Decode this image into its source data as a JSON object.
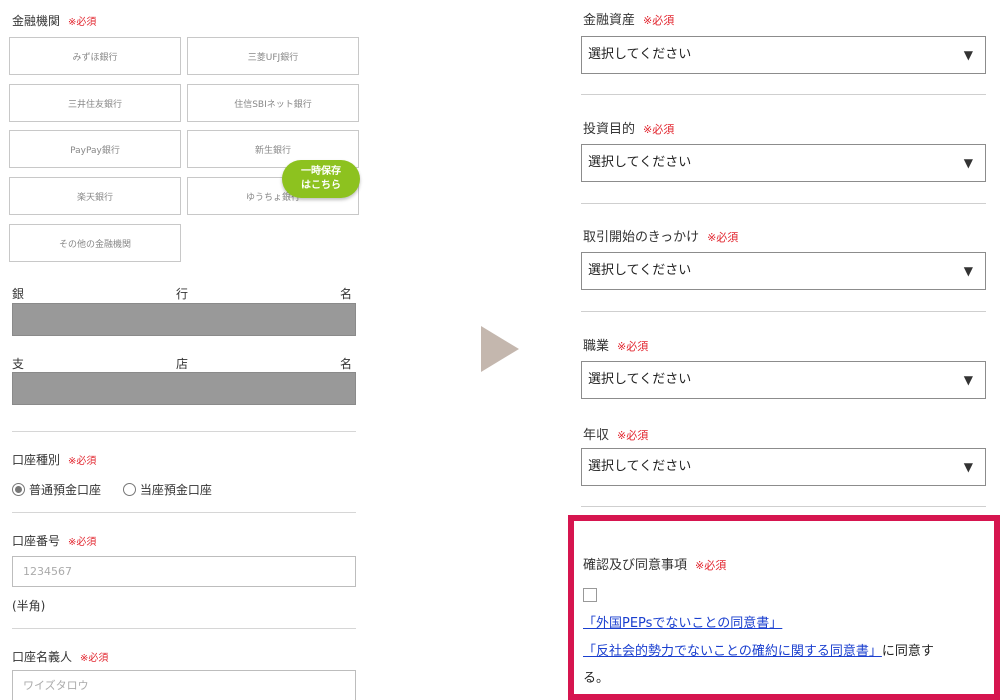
{
  "left": {
    "bank_section": {
      "label": "金融機関",
      "required": "※必須",
      "banks": [
        "みずほ銀行",
        "三菱UFJ銀行",
        "三井住友銀行",
        "住信SBIネット銀行",
        "PayPay銀行",
        "新生銀行",
        "楽天銀行",
        "ゆうちょ銀行",
        "その他の金融機関"
      ]
    },
    "temp_save_badge": {
      "line1": "一時保存",
      "line2": "はこちら"
    },
    "bank_name": {
      "chars": [
        "銀",
        "行",
        "名"
      ]
    },
    "branch_name": {
      "chars": [
        "支",
        "店",
        "名"
      ]
    },
    "account_type": {
      "label": "口座種別",
      "required": "※必須",
      "options": [
        {
          "label": "普通預金口座",
          "selected": true
        },
        {
          "label": "当座預金口座",
          "selected": false
        }
      ]
    },
    "account_number": {
      "label": "口座番号",
      "required": "※必須",
      "placeholder": "1234567",
      "note": "(半角)"
    },
    "account_holder": {
      "label": "口座名義人",
      "required": "※必須",
      "placeholder": "ワイズタロウ"
    }
  },
  "arrow_icon": "triangle-right-icon",
  "right": {
    "financial_assets": {
      "label": "金融資産",
      "required": "※必須",
      "value": "選択してください"
    },
    "investment_purpose": {
      "label": "投資目的",
      "required": "※必須",
      "value": "選択してください"
    },
    "trigger": {
      "label": "取引開始のきっかけ",
      "required": "※必須",
      "value": "選択してください"
    },
    "occupation": {
      "label": "職業",
      "required": "※必須",
      "value": "選択してください"
    },
    "annual_income": {
      "label": "年収",
      "required": "※必須",
      "value": "選択してください"
    },
    "agreement": {
      "label": "確認及び同意事項",
      "required": "※必須",
      "link1": "「外国PEPsでないことの同意書」",
      "link2": "「反社会的勢力でないことの確約に関する同意書」",
      "suffix_a": "に同意す",
      "suffix_b": "る。"
    }
  },
  "colors": {
    "required_red": "#e2262f",
    "highlight_border": "#d6154f",
    "badge_green": "#8dc21f",
    "link_blue": "#1a3fcf"
  }
}
